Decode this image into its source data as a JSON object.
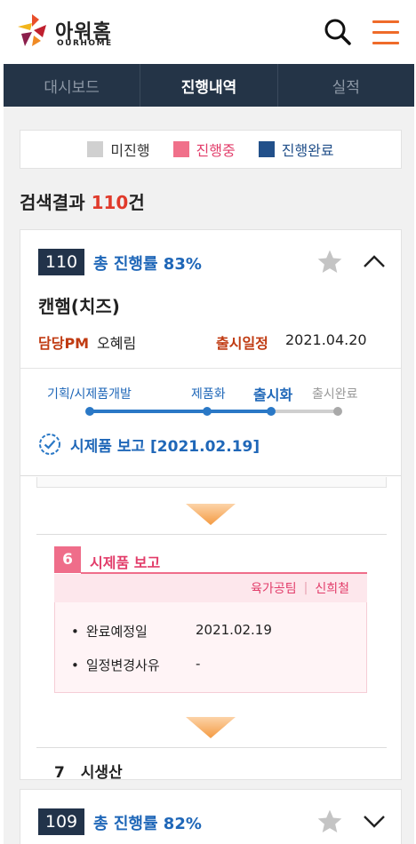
{
  "brand": {
    "name_ko": "아워홈",
    "name_en": "OURHOME"
  },
  "header": {
    "search_icon": "search-icon",
    "menu_icon": "hamburger-menu-icon",
    "menu_color": "#ef6b2a"
  },
  "nav": {
    "tabs": [
      {
        "label": "대시보드"
      },
      {
        "label": "진행내역"
      },
      {
        "label": "실적"
      }
    ],
    "active_index": 1
  },
  "legend": [
    {
      "label": "미진행",
      "color": "#d0d0d0"
    },
    {
      "label": "진행중",
      "color": "#f0708a"
    },
    {
      "label": "진행완료",
      "color": "#22508a"
    }
  ],
  "result": {
    "prefix": "검색결과",
    "count": "110",
    "suffix": "건"
  },
  "projects": [
    {
      "id": "110",
      "progress_label": "총 진행률",
      "progress": "83%",
      "name": "캔햄(치즈)",
      "pm_label": "담당PM",
      "pm": "오혜림",
      "release_label": "출시일정",
      "release_date": "2021.04.20",
      "steps": [
        {
          "label": "기획/시제품개발",
          "state": "done"
        },
        {
          "label": "제품화",
          "state": "done"
        },
        {
          "label": "출시화",
          "state": "current"
        },
        {
          "label": "출시완료",
          "state": "pending"
        }
      ],
      "status": "시제품 보고 [2021.02.19]",
      "stage": {
        "number": "6",
        "title": "시제품 보고",
        "people": [
          "육가공팀",
          "신희철"
        ],
        "rows": [
          {
            "key": "완료예정일",
            "value": "2021.02.19"
          },
          {
            "key": "일정변경사유",
            "value": "-"
          }
        ]
      },
      "next_stage": {
        "number": "7",
        "title": "시생산"
      }
    },
    {
      "id": "109",
      "progress_label": "총 진행률",
      "progress": "82%"
    }
  ]
}
